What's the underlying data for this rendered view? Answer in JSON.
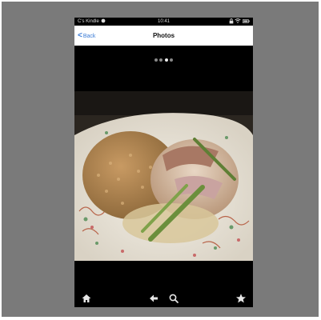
{
  "status_bar": {
    "carrier": "C's Kindle",
    "carrier_icon": "refresh-icon",
    "clock": "10:41",
    "icons": [
      "lock-icon",
      "wifi-icon",
      "battery-icon"
    ]
  },
  "nav": {
    "back_label": "Back",
    "title": "Photos"
  },
  "pager": {
    "count": 4,
    "active_index": 2
  },
  "photo": {
    "subject": "plate of rice, sliced meat and asparagus"
  },
  "toolbar": {
    "icons": [
      "home-icon",
      "back-arrow-icon",
      "search-icon",
      "star-icon"
    ]
  },
  "colors": {
    "background": "#7a7a7a",
    "device": "#000000",
    "navbar": "#ffffff",
    "link": "#3a7bd5"
  }
}
